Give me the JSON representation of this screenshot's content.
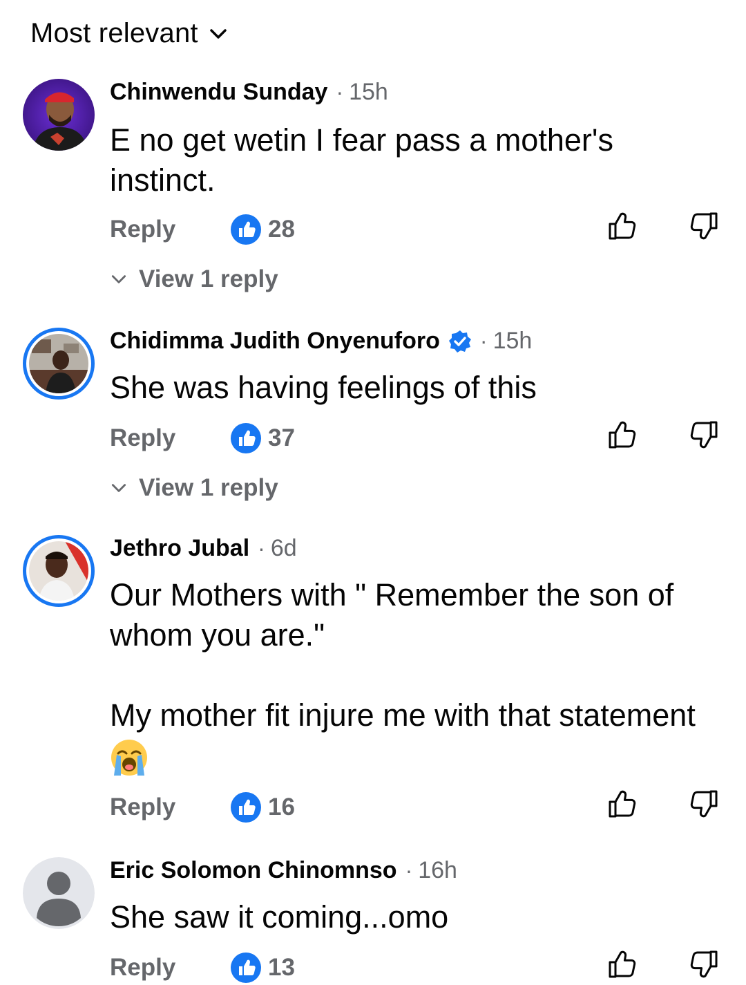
{
  "sort": {
    "label": "Most relevant"
  },
  "comments": [
    {
      "author": "Chinwendu Sunday",
      "separator": "·",
      "time": "15h",
      "text": "E no get wetin I fear pass a mother's\ninstinct.",
      "reply_label": "Reply",
      "like_count": "28",
      "view_replies": "View 1 reply",
      "verified": false
    },
    {
      "author": "Chidimma Judith Onyenuforo",
      "separator": "·",
      "time": "15h",
      "text": "She was having feelings of this",
      "reply_label": "Reply",
      "like_count": "37",
      "view_replies": "View 1 reply",
      "verified": true
    },
    {
      "author": "Jethro Jubal",
      "separator": "·",
      "time": "6d",
      "text": "Our Mothers with \" Remember the son of\nwhom you are.\"\n\nMy mother fit injure me with that statement",
      "reply_label": "Reply",
      "like_count": "16",
      "verified": false
    },
    {
      "author": "Eric Solomon Chinomnso",
      "separator": "·",
      "time": "16h",
      "text": "She saw it coming...omo",
      "reply_label": "Reply",
      "like_count": "13",
      "verified": false
    }
  ],
  "colors": {
    "accent": "#1877f2",
    "secondary_text": "#65676b",
    "primary_text": "#050505"
  },
  "icons": {
    "sort": "chevron-down-icon",
    "verified": "verified-badge-icon",
    "like_badge": "like-reaction-icon",
    "like": "thumbs-up-icon",
    "dislike": "thumbs-down-icon",
    "emoji": "loudly-crying-face-emoji"
  }
}
